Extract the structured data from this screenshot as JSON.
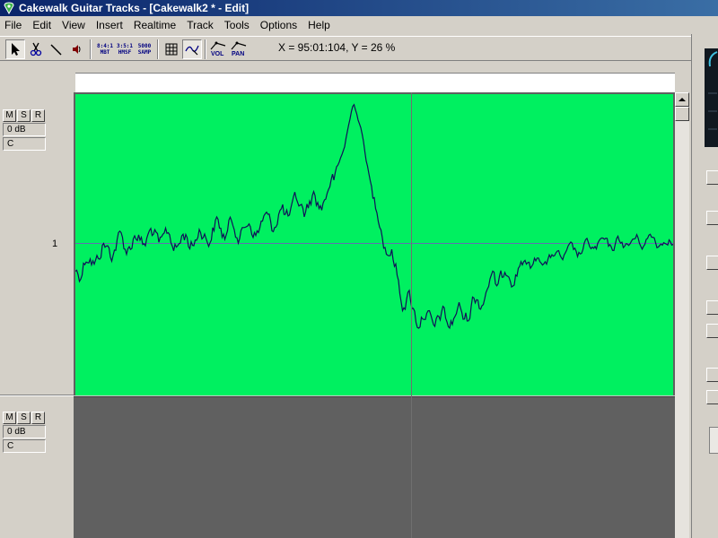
{
  "window": {
    "title": "Cakewalk Guitar Tracks - [Cakewalk2 * - Edit]"
  },
  "menu": [
    "File",
    "Edit",
    "View",
    "Insert",
    "Realtime",
    "Track",
    "Tools",
    "Options",
    "Help"
  ],
  "toolbar": {
    "tools": [
      {
        "name": "select",
        "icon": "arrow-pointer-icon"
      },
      {
        "name": "scissors",
        "icon": "scissors-icon"
      },
      {
        "name": "draw-line",
        "icon": "line-icon"
      },
      {
        "name": "scrub",
        "icon": "speaker-icon"
      }
    ],
    "time_formats": [
      {
        "top": "8:4:1",
        "bottom": "MBT"
      },
      {
        "top": "3:5:1",
        "bottom": "HMSF"
      },
      {
        "top": "5000",
        "bottom": "SAMP"
      }
    ],
    "snap_icon": "grid-icon",
    "envelope_icon": "envelope-curve-icon",
    "vol_label": "VOL",
    "pan_label": "PAN"
  },
  "readout": "X = 95:01:104, Y = 26 %",
  "tracks": [
    {
      "mute": "M",
      "solo": "S",
      "record": "R",
      "volume": "0 dB",
      "pan": "C"
    },
    {
      "mute": "M",
      "solo": "S",
      "record": "R",
      "volume": "0 dB",
      "pan": "C"
    }
  ],
  "envelope": {
    "level_label": "1",
    "clip_color": "#00f060",
    "line_color": "#101058"
  },
  "colors": {
    "titlebar_start": "#0a246a",
    "titlebar_end": "#3a6ea5",
    "empty_track": "#606060"
  }
}
